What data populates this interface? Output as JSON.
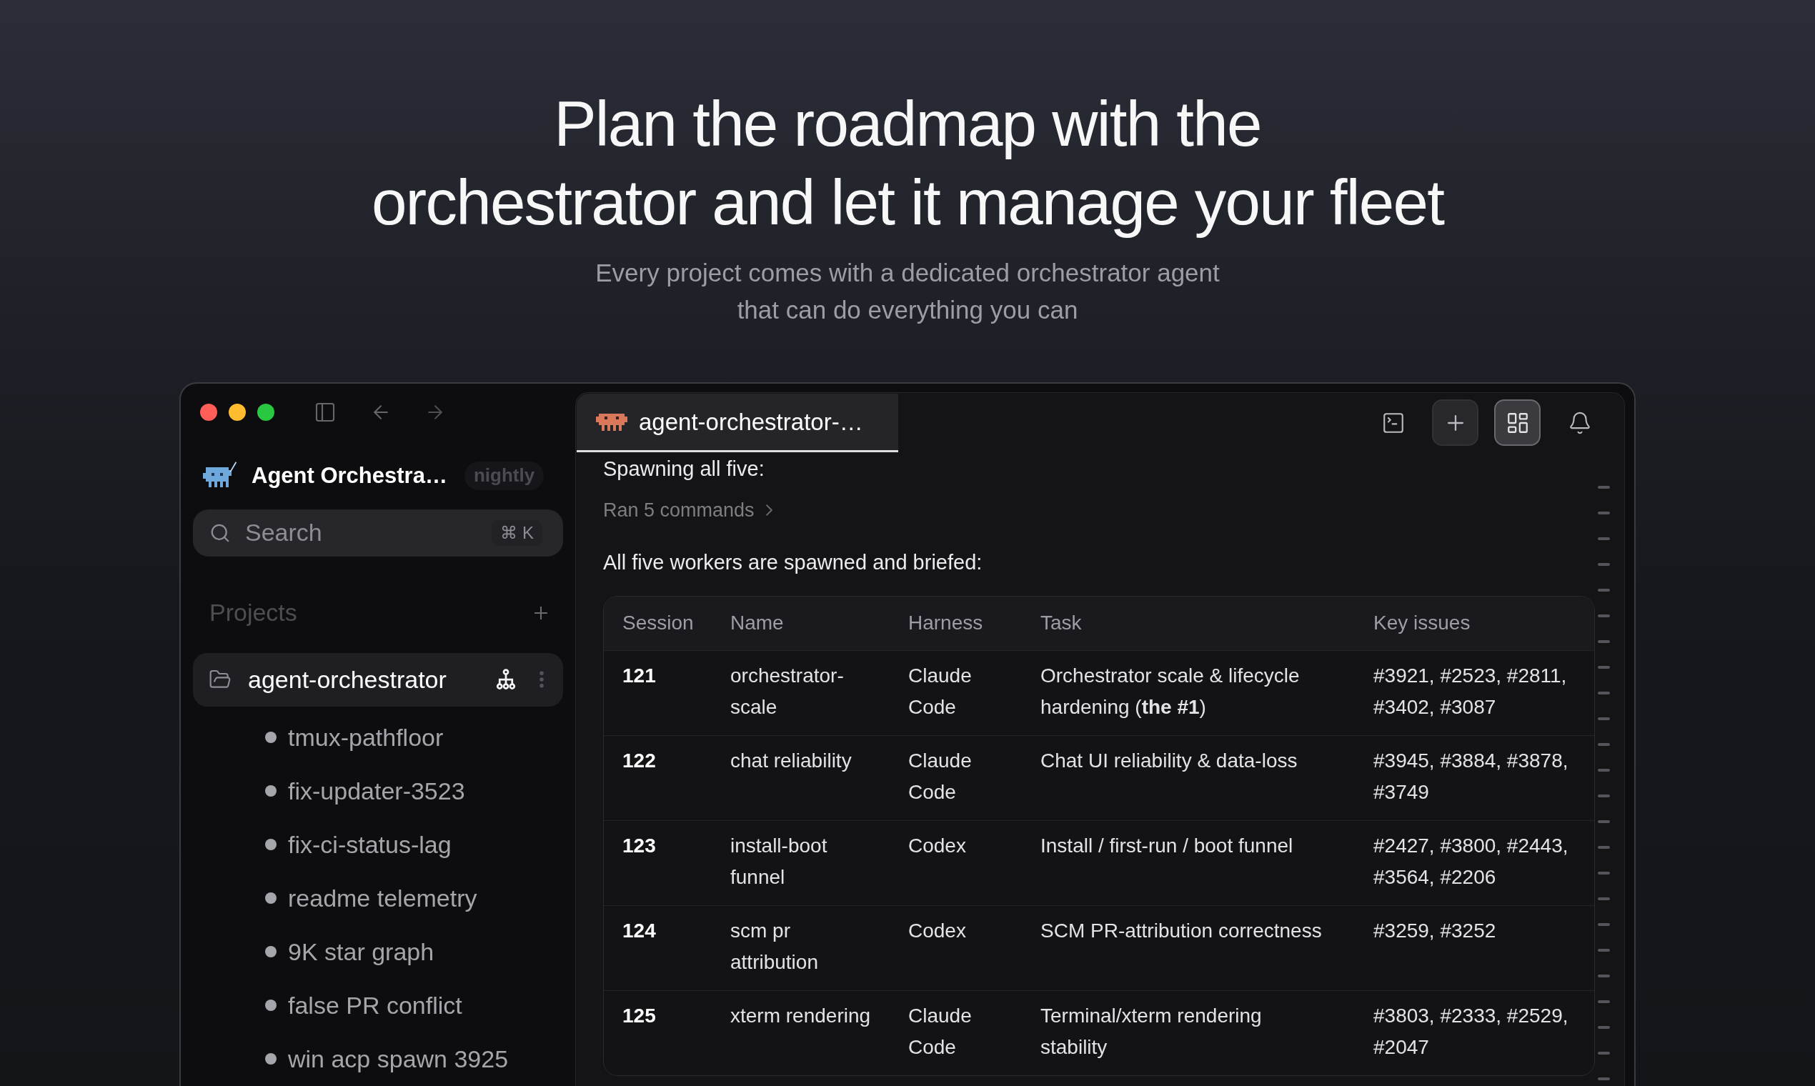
{
  "hero": {
    "title_lines": [
      "Plan the roadmap with the",
      "orchestrator and let it manage your fleet"
    ],
    "subtitle_lines": [
      "Every project comes with a dedicated orchestrator agent",
      "that can do everything you can"
    ]
  },
  "sidebar": {
    "app_name": "Agent Orchestra…",
    "channel_badge": "nightly",
    "search": {
      "placeholder": "Search",
      "shortcut": "⌘ K"
    },
    "section_title": "Projects",
    "projects": [
      {
        "name": "agent-orchestrator",
        "selected": true,
        "children": [
          {
            "name": "tmux-pathfloor",
            "selected": false
          },
          {
            "name": "fix-updater-3523",
            "selected": false
          },
          {
            "name": "fix-ci-status-lag",
            "selected": false
          },
          {
            "name": "readme telemetry",
            "selected": false
          },
          {
            "name": "9K star graph",
            "selected": false
          },
          {
            "name": "false PR conflict",
            "selected": false
          },
          {
            "name": "win acp spawn 3925",
            "selected": false
          }
        ]
      }
    ]
  },
  "tabs": [
    {
      "label": "agent-orchestrator-…",
      "selected": true
    }
  ],
  "toolbar": [
    {
      "kind": "terminal",
      "selected": false
    },
    {
      "kind": "add",
      "selected": false
    },
    {
      "kind": "layout",
      "selected": true
    },
    {
      "kind": "notifications",
      "selected": false
    }
  ],
  "chat": [
    {
      "kind": "text",
      "text": "Spawning all five:"
    },
    {
      "kind": "tool_group",
      "text": "Ran 5 commands",
      "expanded": false
    },
    {
      "kind": "text",
      "text": "All five workers are spawned and briefed:"
    },
    {
      "kind": "table",
      "columns": [
        "Session",
        "Name",
        "Harness",
        "Task",
        "Key issues"
      ],
      "rows": [
        [
          "121",
          "orchestrator-scale",
          "Claude Code",
          "Orchestrator scale & lifecycle hardening (**the #1**)",
          "#3921, #2523, #2811, #3402, #3087"
        ],
        [
          "122",
          "chat reliability",
          "Claude Code",
          "Chat UI reliability & data-loss",
          "#3945, #3884, #3878, #3749"
        ],
        [
          "123",
          "install-boot funnel",
          "Codex",
          "Install / first-run / boot funnel",
          "#2427, #3800, #2443, #3564, #2206"
        ],
        [
          "124",
          "scm pr attribution",
          "Codex",
          "SCM PR-attribution correctness",
          "#3259, #3252"
        ],
        [
          "125",
          "xterm rendering",
          "Claude Code",
          "Terminal/xterm rendering stability",
          "#3803, #2333, #2529, #2047"
        ]
      ]
    }
  ]
}
